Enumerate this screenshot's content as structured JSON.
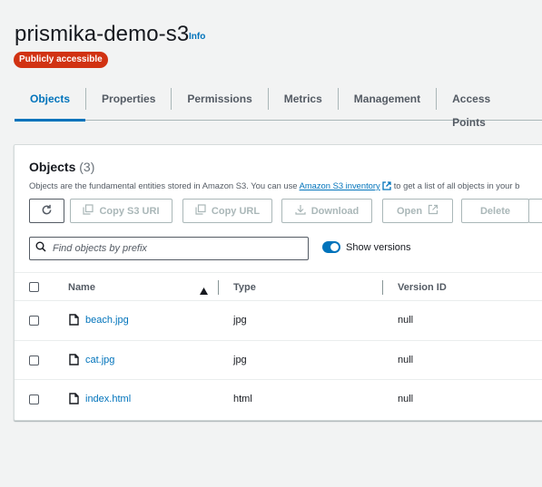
{
  "header": {
    "bucket_name": "prismika-demo-s3",
    "info_label": "Info",
    "access_badge": "Publicly accessible",
    "badge_color": "#d13212"
  },
  "tabs": [
    {
      "label": "Objects",
      "active": true
    },
    {
      "label": "Properties"
    },
    {
      "label": "Permissions"
    },
    {
      "label": "Metrics"
    },
    {
      "label": "Management"
    },
    {
      "label": "Access Points"
    }
  ],
  "objects_panel": {
    "title": "Objects",
    "count": "(3)",
    "description_before": "Objects are the fundamental entities stored in Amazon S3. You can use",
    "description_link": "Amazon S3 inventory",
    "description_after": "to get a list of all objects in your b",
    "buttons": {
      "copy_s3_uri": "Copy S3 URI",
      "copy_url": "Copy URL",
      "download": "Download",
      "open": "Open",
      "delete": "Delete"
    },
    "search": {
      "placeholder": "Find objects by prefix",
      "value": ""
    },
    "show_versions": {
      "label": "Show versions",
      "enabled": true
    },
    "columns": [
      "Name",
      "Type",
      "Version ID"
    ],
    "rows": [
      {
        "name": "beach.jpg",
        "type": "jpg",
        "version_id": "null"
      },
      {
        "name": "cat.jpg",
        "type": "jpg",
        "version_id": "null"
      },
      {
        "name": "index.html",
        "type": "html",
        "version_id": "null"
      }
    ]
  },
  "colors": {
    "accent": "#0073bb",
    "disabled": "#aab7b8",
    "text": "#16191f"
  }
}
